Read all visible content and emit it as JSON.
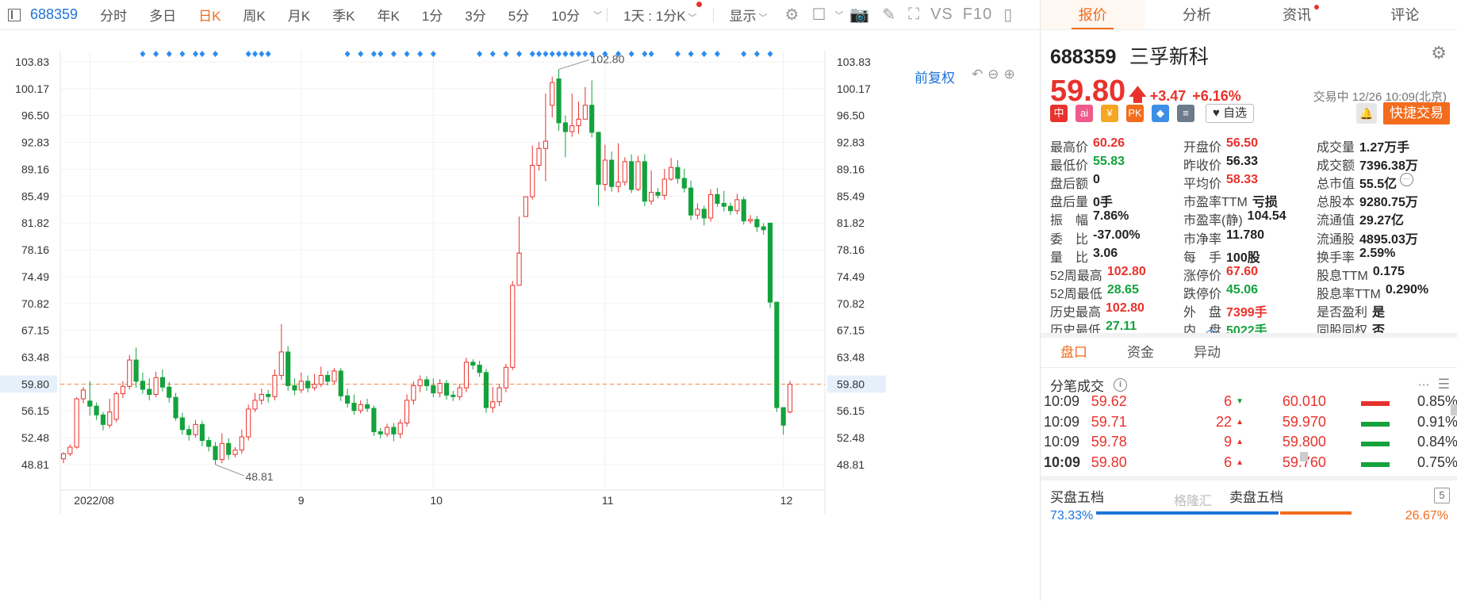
{
  "toolbar": {
    "code": "688359",
    "periods": [
      "分时",
      "多日",
      "日K",
      "周K",
      "月K",
      "季K",
      "年K",
      "1分",
      "3分",
      "5分",
      "10分"
    ],
    "active_period": "日K",
    "multi_period": "1天 : 1分K",
    "display": "显示",
    "vs_label": "VS",
    "f10_label": "F10"
  },
  "chart": {
    "adjust_label": "前复权",
    "y_ticks": [
      "103.83",
      "100.17",
      "96.50",
      "92.83",
      "89.16",
      "85.49",
      "81.82",
      "78.16",
      "74.49",
      "70.82",
      "67.15",
      "63.48",
      "59.80",
      "56.15",
      "52.48",
      "48.81"
    ],
    "x_labels": [
      "2022/08",
      "9",
      "10",
      "11",
      "12"
    ],
    "current_price_label": "59.80",
    "max_label": "102.80",
    "min_label": "48.81"
  },
  "chart_data": {
    "type": "candlestick",
    "y_axis_ticks": [
      103.83,
      100.17,
      96.5,
      92.83,
      89.16,
      85.49,
      81.82,
      78.16,
      74.49,
      70.82,
      67.15,
      63.48,
      59.8,
      56.15,
      52.48,
      48.81
    ],
    "x_axis_labels": [
      "2022/08",
      "9",
      "10",
      "11",
      "12"
    ],
    "current_price": 59.8,
    "period_high": 102.8,
    "period_low": 48.81,
    "candles": [
      [
        49.6,
        50.3,
        49.0,
        50.5
      ],
      [
        50.3,
        51.2,
        50.0,
        51.6
      ],
      [
        51.2,
        57.8,
        51.0,
        58.0
      ],
      [
        57.8,
        59.0,
        57.2,
        59.4
      ],
      [
        57.5,
        56.8,
        55.5,
        60.2
      ],
      [
        56.8,
        55.6,
        54.9,
        57.3
      ],
      [
        55.6,
        54.3,
        53.5,
        56.0
      ],
      [
        54.2,
        56.0,
        53.8,
        57.8
      ],
      [
        55.0,
        58.5,
        54.6,
        58.8
      ],
      [
        58.5,
        59.5,
        57.9,
        60.2
      ],
      [
        59.5,
        63.1,
        59.1,
        63.8
      ],
      [
        63.1,
        60.2,
        59.3,
        64.8
      ],
      [
        60.2,
        59.1,
        58.5,
        61.4
      ],
      [
        59.1,
        58.4,
        57.6,
        60.6
      ],
      [
        58.4,
        60.7,
        58.0,
        61.5
      ],
      [
        60.7,
        59.4,
        58.8,
        61.8
      ],
      [
        59.4,
        58.0,
        57.3,
        60.1
      ],
      [
        58.0,
        55.2,
        54.8,
        58.6
      ],
      [
        55.2,
        53.6,
        52.9,
        55.9
      ],
      [
        53.6,
        52.9,
        52.1,
        54.2
      ],
      [
        52.9,
        54.3,
        52.5,
        54.9
      ],
      [
        54.3,
        52.1,
        51.3,
        54.8
      ],
      [
        52.1,
        51.3,
        50.6,
        52.6
      ],
      [
        51.3,
        49.5,
        48.81,
        51.9
      ],
      [
        49.5,
        51.7,
        49.0,
        53.1
      ],
      [
        51.7,
        50.2,
        49.5,
        52.4
      ],
      [
        50.2,
        50.8,
        49.8,
        51.2
      ],
      [
        50.8,
        52.6,
        50.3,
        53.6
      ],
      [
        52.6,
        56.4,
        52.1,
        57.0
      ],
      [
        56.4,
        57.6,
        56.0,
        58.6
      ],
      [
        57.6,
        58.4,
        57.0,
        59.2
      ],
      [
        58.4,
        58.1,
        57.3,
        59.0
      ],
      [
        58.1,
        61.0,
        57.6,
        61.8
      ],
      [
        61.0,
        64.2,
        60.4,
        68.0
      ],
      [
        64.2,
        59.6,
        58.9,
        65.0
      ],
      [
        59.6,
        59.0,
        58.3,
        60.6
      ],
      [
        59.0,
        60.2,
        58.6,
        61.4
      ],
      [
        60.2,
        59.3,
        58.7,
        61.0
      ],
      [
        59.3,
        59.8,
        58.9,
        61.2
      ],
      [
        59.8,
        61.0,
        59.4,
        62.2
      ],
      [
        61.0,
        60.2,
        59.6,
        61.6
      ],
      [
        60.2,
        61.6,
        59.8,
        62.0
      ],
      [
        61.6,
        58.2,
        57.5,
        62.0
      ],
      [
        58.2,
        57.2,
        56.6,
        59.2
      ],
      [
        57.2,
        56.2,
        55.6,
        58.4
      ],
      [
        56.2,
        57.0,
        55.8,
        57.6
      ],
      [
        57.0,
        56.5,
        56.0,
        57.8
      ],
      [
        56.5,
        53.3,
        52.7,
        56.9
      ],
      [
        53.3,
        53.0,
        52.4,
        53.8
      ],
      [
        53.0,
        53.9,
        52.6,
        54.4
      ],
      [
        53.9,
        53.0,
        52.0,
        54.5
      ],
      [
        53.0,
        54.5,
        52.4,
        55.0
      ],
      [
        54.5,
        57.6,
        54.0,
        58.4
      ],
      [
        57.6,
        59.6,
        57.0,
        60.2
      ],
      [
        59.6,
        60.4,
        58.7,
        61.0
      ],
      [
        60.4,
        59.6,
        58.9,
        60.9
      ],
      [
        59.6,
        58.6,
        58.0,
        60.6
      ],
      [
        58.6,
        59.9,
        58.0,
        60.5
      ],
      [
        59.9,
        58.3,
        57.7,
        60.4
      ],
      [
        58.3,
        58.1,
        57.5,
        58.9
      ],
      [
        58.1,
        59.3,
        57.6,
        59.8
      ],
      [
        59.3,
        62.8,
        58.7,
        63.4
      ],
      [
        62.8,
        62.4,
        61.8,
        63.2
      ],
      [
        62.4,
        61.4,
        60.8,
        63.0
      ],
      [
        61.4,
        56.6,
        55.9,
        61.9
      ],
      [
        56.6,
        57.4,
        55.9,
        59.4
      ],
      [
        57.4,
        59.3,
        56.8,
        59.8
      ],
      [
        59.3,
        62.1,
        58.7,
        62.6
      ],
      [
        62.1,
        73.3,
        61.7,
        73.9
      ],
      [
        73.3,
        77.7,
        75.0,
        82.7
      ],
      [
        82.7,
        85.4,
        83.7,
        85.4
      ],
      [
        85.4,
        89.7,
        85.0,
        92.4
      ],
      [
        89.7,
        92.0,
        89.0,
        92.9
      ],
      [
        92.0,
        93.0,
        87.5,
        99.5
      ],
      [
        97.9,
        101.0,
        96.2,
        101.8
      ],
      [
        101.5,
        95.5,
        94.4,
        102.8
      ],
      [
        95.5,
        94.3,
        90.8,
        96.5
      ],
      [
        94.3,
        95.1,
        93.6,
        99.5
      ],
      [
        95.1,
        96.0,
        94.0,
        98.4
      ],
      [
        96.0,
        97.9,
        96.3,
        100.4
      ],
      [
        97.9,
        94.2,
        93.5,
        101.3
      ],
      [
        94.2,
        87.1,
        84.1,
        94.2
      ],
      [
        87.1,
        90.4,
        86.2,
        92.5
      ],
      [
        90.4,
        86.8,
        86.1,
        91.6
      ],
      [
        86.8,
        87.4,
        86.0,
        92.7
      ],
      [
        87.4,
        90.2,
        86.9,
        90.8
      ],
      [
        90.2,
        86.4,
        85.9,
        91.2
      ],
      [
        86.4,
        90.2,
        86.2,
        91.0
      ],
      [
        90.2,
        84.8,
        84.1,
        91.2
      ],
      [
        84.8,
        86.0,
        84.3,
        89.0
      ],
      [
        86.0,
        85.6,
        85.2,
        86.6
      ],
      [
        85.6,
        87.8,
        85.0,
        89.2
      ],
      [
        87.8,
        89.4,
        87.6,
        90.7
      ],
      [
        89.4,
        87.9,
        87.2,
        90.4
      ],
      [
        87.9,
        86.6,
        86.0,
        89.2
      ],
      [
        86.6,
        82.9,
        82.2,
        87.6
      ],
      [
        82.9,
        83.7,
        82.3,
        84.5
      ],
      [
        83.7,
        82.5,
        81.5,
        84.2
      ],
      [
        82.5,
        85.7,
        82.0,
        86.4
      ],
      [
        85.7,
        84.5,
        84.0,
        86.6
      ],
      [
        84.5,
        84.1,
        83.4,
        86.2
      ],
      [
        84.1,
        83.5,
        82.9,
        84.6
      ],
      [
        83.5,
        85.0,
        83.0,
        85.8
      ],
      [
        85.0,
        82.1,
        81.6,
        85.4
      ],
      [
        82.1,
        82.3,
        81.7,
        82.9
      ],
      [
        82.3,
        81.3,
        80.6,
        82.8
      ],
      [
        81.3,
        80.9,
        80.2,
        81.8
      ],
      [
        81.8,
        71.0,
        70.2,
        81.8
      ],
      [
        71.0,
        56.6,
        56.0,
        71.0
      ],
      [
        56.6,
        54.2,
        52.9,
        56.6
      ],
      [
        56.0,
        59.8,
        55.8,
        60.26
      ]
    ]
  },
  "panel": {
    "tabs": [
      "报价",
      "分析",
      "资讯",
      "评论"
    ],
    "code": "688359",
    "name": "三孚新科",
    "price": "59.80",
    "change": "+3.47",
    "change_pct": "+6.16%",
    "status": "交易中 12/26 10:09(北京)",
    "badges": [
      "中",
      "ai",
      "¥",
      "PK",
      "◆",
      "≡"
    ],
    "zixuan": "自选",
    "quick_trade": "快捷交易",
    "collapse_label": "︿",
    "quote_rows": [
      [
        {
          "l": "最高价",
          "v": "60.26",
          "c": "red"
        },
        {
          "l": "开盘价",
          "v": "56.50",
          "c": "red"
        },
        {
          "l": "成交量",
          "v": "1.27万手",
          "c": ""
        }
      ],
      [
        {
          "l": "最低价",
          "v": "55.83",
          "c": "green"
        },
        {
          "l": "昨收价",
          "v": "56.33",
          "c": ""
        },
        {
          "l": "成交额",
          "v": "7396.38万",
          "c": ""
        }
      ],
      [
        {
          "l": "盘后额",
          "v": "0",
          "c": ""
        },
        {
          "l": "平均价",
          "v": "58.33",
          "c": "red"
        },
        {
          "l": "总市值",
          "v": "55.5亿",
          "c": "",
          "more": "···"
        }
      ],
      [
        {
          "l": "盘后量",
          "v": "0手",
          "c": ""
        },
        {
          "l": "市盈率TTM",
          "v": "亏损",
          "c": ""
        },
        {
          "l": "总股本",
          "v": "9280.75万",
          "c": ""
        }
      ],
      [
        {
          "l": "振　幅",
          "v": "7.86%",
          "c": ""
        },
        {
          "l": "市盈率(静)",
          "v": "104.54",
          "c": ""
        },
        {
          "l": "流通值",
          "v": "29.27亿",
          "c": ""
        }
      ],
      [
        {
          "l": "委　比",
          "v": "-37.00%",
          "c": ""
        },
        {
          "l": "市净率",
          "v": "11.780",
          "c": ""
        },
        {
          "l": "流通股",
          "v": "4895.03万",
          "c": ""
        }
      ],
      [
        {
          "l": "量　比",
          "v": "3.06",
          "c": ""
        },
        {
          "l": "每　手",
          "v": "100股",
          "c": ""
        },
        {
          "l": "换手率",
          "v": "2.59%",
          "c": ""
        }
      ],
      [
        {
          "l": "52周最高",
          "v": "102.80",
          "c": "red"
        },
        {
          "l": "涨停价",
          "v": "67.60",
          "c": "red"
        },
        {
          "l": "股息TTM",
          "v": "0.175",
          "c": ""
        }
      ],
      [
        {
          "l": "52周最低",
          "v": "28.65",
          "c": "green"
        },
        {
          "l": "跌停价",
          "v": "45.06",
          "c": "green"
        },
        {
          "l": "股息率TTM",
          "v": "0.290%",
          "c": ""
        }
      ],
      [
        {
          "l": "历史最高",
          "v": "102.80",
          "c": "red"
        },
        {
          "l": "外　盘",
          "v": "7399手",
          "c": "red"
        },
        {
          "l": "是否盈利",
          "v": "是",
          "c": ""
        }
      ],
      [
        {
          "l": "历史最低",
          "v": "27.11",
          "c": "green"
        },
        {
          "l": "内　盘",
          "v": "5022手",
          "c": "green"
        },
        {
          "l": "同股同权",
          "v": "否",
          "c": ""
        }
      ]
    ],
    "section_tabs": [
      "盘口",
      "资金",
      "异动"
    ],
    "tick_title": "分笔成交",
    "ticks": [
      {
        "time": "10:09",
        "price": "59.62",
        "vol": "6",
        "dir": "down",
        "lv": "60.010",
        "bar": "red",
        "pct": "0.85%"
      },
      {
        "time": "10:09",
        "price": "59.71",
        "vol": "22",
        "dir": "up",
        "lv": "59.970",
        "bar": "green",
        "pct": "0.91%"
      },
      {
        "time": "10:09",
        "price": "59.78",
        "vol": "9",
        "dir": "up",
        "lv": "59.800",
        "bar": "green",
        "pct": "0.84%"
      },
      {
        "time": "10:09",
        "price": "59.80",
        "vol": "6",
        "dir": "up",
        "lv": "59.760",
        "bar": "green",
        "pct": "0.75%"
      }
    ],
    "buy5": "买盘五档",
    "sell5": "卖盘五档",
    "depth_label": "5",
    "buy_pct": "73.33%",
    "sell_pct": "26.67%",
    "watermark": "格隆汇"
  },
  "colors": {
    "up": "#e8322c",
    "down": "#14a23d",
    "accent": "#f36b1c",
    "link": "#1e74d8"
  }
}
